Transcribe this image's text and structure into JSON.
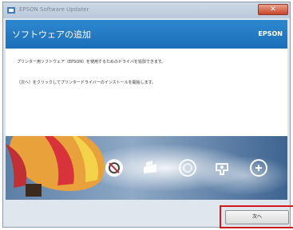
{
  "window": {
    "title": "EPSON Software Updater",
    "close_glyph": "✕"
  },
  "header": {
    "title": "ソフトウェアの追加",
    "brand": "EPSON"
  },
  "content": {
    "line1": "プリンター用ソフトウェア（EPSON）を使用するためのドライバを追加できます。",
    "line2": "〔次へ〕をクリックしてプリンタードライバーのインストールを開始します。"
  },
  "banner": {
    "icons": [
      "scanner-disc-icon",
      "printer-icon",
      "cd-icon",
      "network-icon",
      "plus-circle-icon"
    ]
  },
  "buttons": {
    "next_label": "次へ"
  },
  "colors": {
    "header": "#1f77c1",
    "highlight": "#d0191b"
  }
}
